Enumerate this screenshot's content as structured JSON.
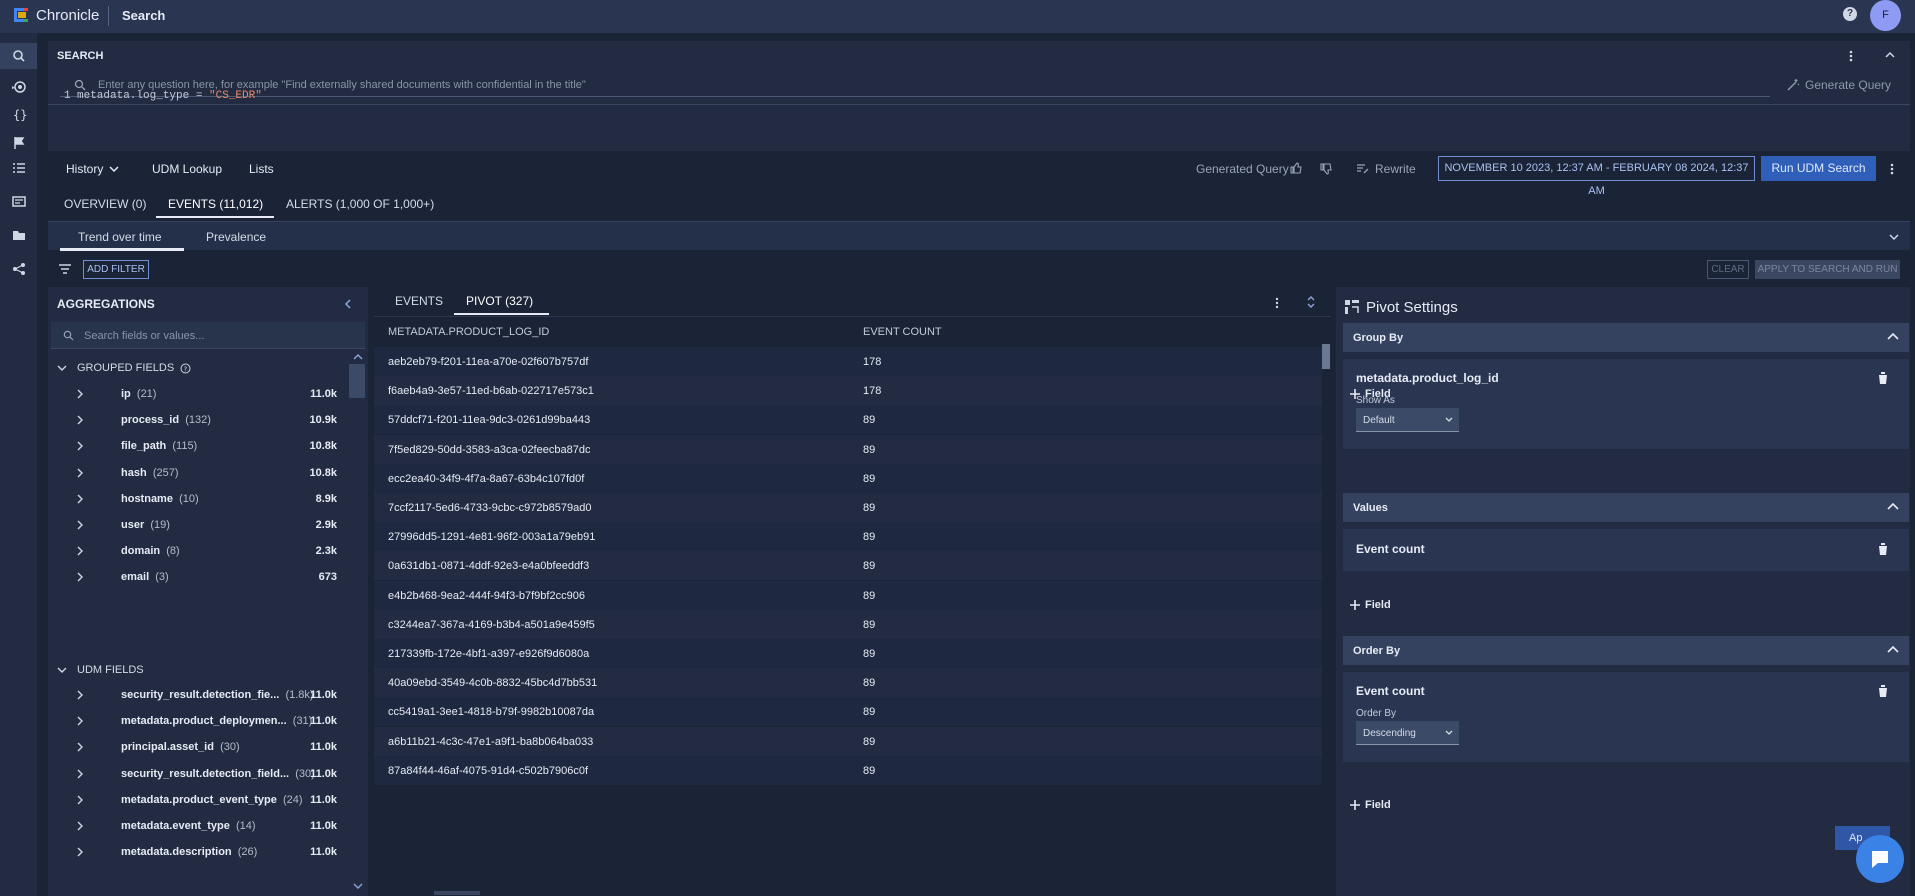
{
  "app": {
    "brand": "Chronicle",
    "page_title": "Search",
    "help": "?",
    "avatar_initial": "F"
  },
  "search": {
    "label": "SEARCH",
    "placeholder": "Enter any question here, for example \"Find externally shared documents with confidential in the title\"",
    "generate_query": "Generate Query",
    "line_number": "1",
    "code_prefix": "metadata.log_type = ",
    "code_string": "\"CS_EDR\""
  },
  "toolbar": {
    "history": "History",
    "udm_lookup": "UDM Lookup",
    "lists": "Lists",
    "generated_query": "Generated Query",
    "rewrite": "Rewrite",
    "date_range": "NOVEMBER 10 2023, 12:37 AM - FEBRUARY 08 2024, 12:37 AM",
    "run": "Run UDM Search"
  },
  "result_tabs": [
    {
      "label": "OVERVIEW (0)"
    },
    {
      "label": "EVENTS (11,012)"
    },
    {
      "label": "ALERTS (1,000 OF 1,000+)"
    }
  ],
  "trend_tabs": [
    {
      "label": "Trend over time"
    },
    {
      "label": "Prevalence"
    }
  ],
  "filterbar": {
    "add_filter": "ADD FILTER",
    "clear": "CLEAR",
    "apply": "APPLY TO SEARCH AND RUN"
  },
  "aggregations": {
    "title": "AGGREGATIONS",
    "search_placeholder": "Search fields or values...",
    "grouped_label": "GROUPED FIELDS",
    "grouped": [
      {
        "name": "ip",
        "count": "(21)",
        "value": "11.0k"
      },
      {
        "name": "process_id",
        "count": "(132)",
        "value": "10.9k"
      },
      {
        "name": "file_path",
        "count": "(115)",
        "value": "10.8k"
      },
      {
        "name": "hash",
        "count": "(257)",
        "value": "10.8k"
      },
      {
        "name": "hostname",
        "count": "(10)",
        "value": "8.9k"
      },
      {
        "name": "user",
        "count": "(19)",
        "value": "2.9k"
      },
      {
        "name": "domain",
        "count": "(8)",
        "value": "2.3k"
      },
      {
        "name": "email",
        "count": "(3)",
        "value": "673"
      }
    ],
    "udm_label": "UDM FIELDS",
    "udm": [
      {
        "name": "security_result.detection_fie...",
        "count": "(1.8k)",
        "value": "11.0k"
      },
      {
        "name": "metadata.product_deploymen...",
        "count": "(31)",
        "value": "11.0k"
      },
      {
        "name": "principal.asset_id",
        "count": "(30)",
        "value": "11.0k"
      },
      {
        "name": "security_result.detection_field...",
        "count": "(30)",
        "value": "11.0k"
      },
      {
        "name": "metadata.product_event_type",
        "count": "(24)",
        "value": "11.0k"
      },
      {
        "name": "metadata.event_type",
        "count": "(14)",
        "value": "11.0k"
      },
      {
        "name": "metadata.description",
        "count": "(26)",
        "value": "11.0k"
      }
    ]
  },
  "pivot": {
    "tabs": [
      {
        "label": "EVENTS"
      },
      {
        "label": "PIVOT (327)"
      }
    ],
    "columns": [
      "METADATA.PRODUCT_LOG_ID",
      "EVENT COUNT"
    ],
    "rows": [
      {
        "id": "aeb2eb79-f201-11ea-a70e-02f607b757df",
        "count": "178"
      },
      {
        "id": "f6aeb4a9-3e57-11ed-b6ab-022717e573c1",
        "count": "178"
      },
      {
        "id": "57ddcf71-f201-11ea-9dc3-0261d99ba443",
        "count": "89"
      },
      {
        "id": "7f5ed829-50dd-3583-a3ca-02feecba87dc",
        "count": "89"
      },
      {
        "id": "ecc2ea40-34f9-4f7a-8a67-63b4c107fd0f",
        "count": "89"
      },
      {
        "id": "7ccf2117-5ed6-4733-9cbc-c972b8579ad0",
        "count": "89"
      },
      {
        "id": "27996dd5-1291-4e81-96f2-003a1a79eb91",
        "count": "89"
      },
      {
        "id": "0a631db1-0871-4ddf-92e3-e4a0bfeeddf3",
        "count": "89"
      },
      {
        "id": "e4b2b468-9ea2-444f-94f3-b7f9bf2cc906",
        "count": "89"
      },
      {
        "id": "c3244ea7-367a-4169-b3b4-a501a9e459f5",
        "count": "89"
      },
      {
        "id": "217339fb-172e-4bf1-a397-e926f9d6080a",
        "count": "89"
      },
      {
        "id": "40a09ebd-3549-4c0b-8832-45bc4d7bb531",
        "count": "89"
      },
      {
        "id": "cc5419a1-3ee1-4818-b79f-9982b10087da",
        "count": "89"
      },
      {
        "id": "a6b11b21-4c3c-47e1-a9f1-ba8b064ba033",
        "count": "89"
      },
      {
        "id": "87a84f44-46af-4075-91d4-c502b7906c0f",
        "count": "89"
      }
    ]
  },
  "settings": {
    "title": "Pivot Settings",
    "group_by": "Group By",
    "group_field": "metadata.product_log_id",
    "show_as_label": "Show As",
    "show_as_value": "Default",
    "add_field": "Field",
    "values": "Values",
    "value_field": "Event count",
    "order_by": "Order By",
    "order_field": "Event count",
    "order_by_label": "Order By",
    "order_value": "Descending",
    "apply_partial": "Ap"
  }
}
